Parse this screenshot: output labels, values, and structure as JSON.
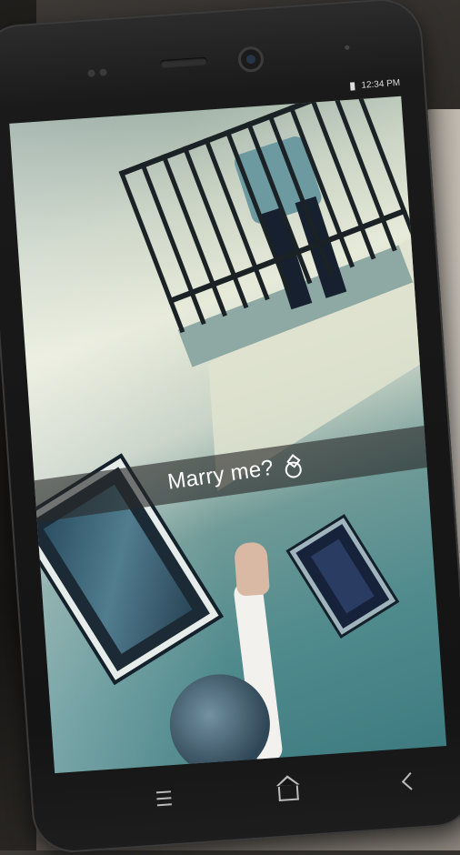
{
  "statusbar": {
    "time": "12:34 PM"
  },
  "snap": {
    "caption": "Marry me?",
    "caption_icon": "ring-icon"
  },
  "navbar": {
    "menu_icon": "menu-icon",
    "home_icon": "home-icon",
    "back_icon": "back-icon"
  }
}
